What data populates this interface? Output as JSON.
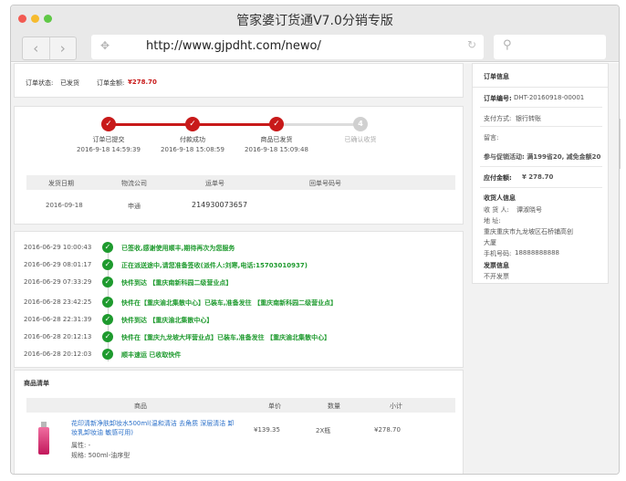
{
  "window": {
    "title": "管家婆订货通V7.0分销专版",
    "url": "http://www.gjpdht.com/newo/",
    "nav_back": "‹",
    "nav_forward": "›"
  },
  "colors": {
    "accent": "#c81a1a",
    "success": "#1e9a2e",
    "link": "#2a6fc9"
  },
  "order_status": {
    "status_label": "订单状态:",
    "status_value": "已发货",
    "amount_label": "订单金额:",
    "amount_value": "¥278.70"
  },
  "progress": {
    "steps": [
      {
        "label": "订单已提交",
        "time": "2016-9-18 14:59:39",
        "done": true
      },
      {
        "label": "付款成功",
        "time": "2016-9-18 15:08:59",
        "done": true
      },
      {
        "label": "商品已发货",
        "time": "2016-9-18 15:09:48",
        "done": true
      },
      {
        "label": "已确认收货",
        "time": "",
        "done": false,
        "number": "4"
      }
    ]
  },
  "shipping": {
    "headers": [
      "发货日期",
      "物流公司",
      "运单号",
      "回单号码号"
    ],
    "row": {
      "date": "2016-09-18",
      "company": "申通",
      "tracking_no": "214930073657",
      "receipt_no": ""
    }
  },
  "logistics": [
    {
      "time": "2016-06-29 10:00:43",
      "msg": "已签收,感谢使用顺丰,期待再次为您服务"
    },
    {
      "time": "2016-06-29 08:01:17",
      "msg": "正在派送途中,请您准备签收(派件人:刘寒,电话:15703010937)"
    },
    {
      "time": "2016-06-29 07:33:29",
      "msg": "快件到达 【重庆南新科园二级营业点】"
    },
    {
      "time": "2016-06-28 23:42:25",
      "msg": "快件在【重庆渝北集散中心】已装车,准备发往 【重庆南新科园二级营业点】"
    },
    {
      "time": "2016-06-28 22:31:39",
      "msg": "快件到达 【重庆渝北集散中心】"
    },
    {
      "time": "2016-06-28 20:12:13",
      "msg": "快件在【重庆九龙坡大坪营业点】已装车,准备发往 【重庆渝北集散中心】"
    },
    {
      "time": "2016-06-28 20:12:03",
      "msg": "顺丰速运 已收取快件"
    }
  ],
  "goods": {
    "title": "商品清单",
    "headers": [
      "商品",
      "单价",
      "数量",
      "小计"
    ],
    "items": [
      {
        "name": "花印清新净肤卸妆水500ml(温和清洁 去角质 深层清洁 卸妆乳卸妆油 敏感可用)",
        "attr": "属性: -",
        "spec": "规格: 500ml-油序型",
        "price": "¥139.35",
        "qty": "2X瓶",
        "subtotal": "¥278.70"
      }
    ]
  },
  "order_info": {
    "title": "订单信息",
    "order_no_label": "订单编号:",
    "order_no": "DHT-20160918-00001",
    "pay_label": "支付方式:",
    "pay_value": "银行转账",
    "note_label": "留言:",
    "promo": "参与促销活动: 满199省20, 减免金额20",
    "total_label": "应付金额:",
    "total_value": "¥ 278.70",
    "receiver_title": "收货人信息",
    "receiver_label": "收 货 人:",
    "receiver_value": "谭淑晓号",
    "address_label": "地     址:",
    "address_value": "重庆重庆市九龙坡区石桥铺高创",
    "address_extra": "大厦",
    "phone_label": "手机号码:",
    "phone_value": "18888888888",
    "invoice_title": "发票信息",
    "invoice_value": "不开发票"
  }
}
